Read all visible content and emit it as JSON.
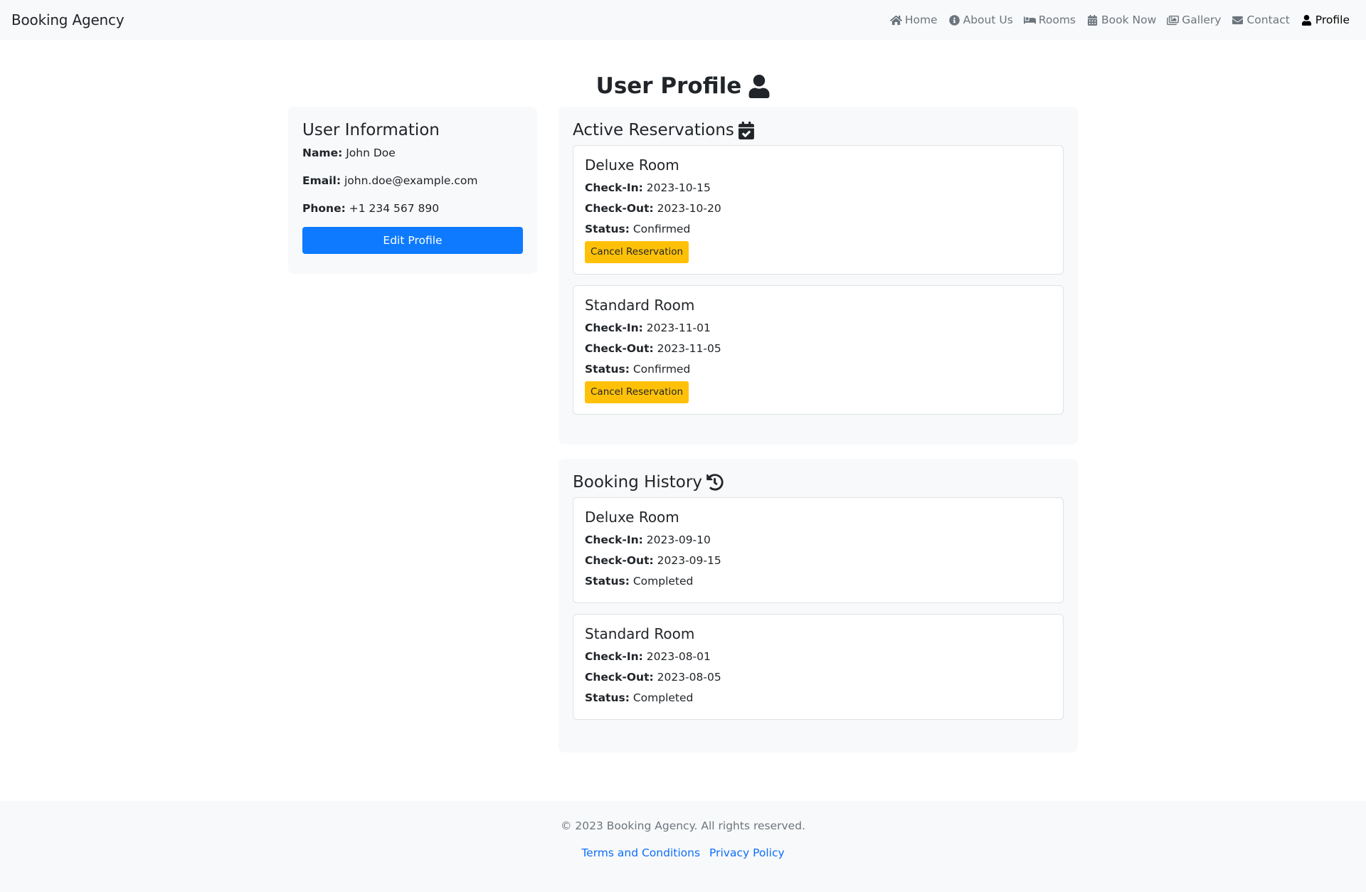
{
  "navbar": {
    "brand": "Booking Agency",
    "items": [
      {
        "label": "Home",
        "icon": "home-icon"
      },
      {
        "label": "About Us",
        "icon": "info-icon"
      },
      {
        "label": "Rooms",
        "icon": "bed-icon"
      },
      {
        "label": "Book Now",
        "icon": "calendar-icon"
      },
      {
        "label": "Gallery",
        "icon": "images-icon"
      },
      {
        "label": "Contact",
        "icon": "envelope-icon"
      },
      {
        "label": "Profile",
        "icon": "user-icon",
        "active": true
      }
    ]
  },
  "page": {
    "title": "User Profile",
    "title_icon": "user-icon"
  },
  "user_info": {
    "title": "User Information",
    "name_label": "Name:",
    "name": "John Doe",
    "email_label": "Email:",
    "email": "john.doe@example.com",
    "phone_label": "Phone:",
    "phone": "+1 234 567 890",
    "edit_button": "Edit Profile"
  },
  "active_reservations": {
    "title": "Active Reservations",
    "title_icon": "calendar-check-icon",
    "items": [
      {
        "room": "Deluxe Room",
        "checkin_label": "Check-In:",
        "checkin": "2023-10-15",
        "checkout_label": "Check-Out:",
        "checkout": "2023-10-20",
        "status_label": "Status:",
        "status": "Confirmed",
        "cancel_label": "Cancel Reservation"
      },
      {
        "room": "Standard Room",
        "checkin_label": "Check-In:",
        "checkin": "2023-11-01",
        "checkout_label": "Check-Out:",
        "checkout": "2023-11-05",
        "status_label": "Status:",
        "status": "Confirmed",
        "cancel_label": "Cancel Reservation"
      }
    ]
  },
  "booking_history": {
    "title": "Booking History",
    "title_icon": "history-icon",
    "items": [
      {
        "room": "Deluxe Room",
        "checkin_label": "Check-In:",
        "checkin": "2023-09-10",
        "checkout_label": "Check-Out:",
        "checkout": "2023-09-15",
        "status_label": "Status:",
        "status": "Completed"
      },
      {
        "room": "Standard Room",
        "checkin_label": "Check-In:",
        "checkin": "2023-08-01",
        "checkout_label": "Check-Out:",
        "checkout": "2023-08-05",
        "status_label": "Status:",
        "status": "Completed"
      }
    ]
  },
  "footer": {
    "copyright": "© 2023 Booking Agency. All rights reserved.",
    "links": [
      "Terms and Conditions",
      "Privacy Policy"
    ]
  },
  "colors": {
    "primary": "#0d7aff",
    "warning": "#ffc107",
    "link": "#0d6efd",
    "panel_bg": "#f8f9fa"
  }
}
